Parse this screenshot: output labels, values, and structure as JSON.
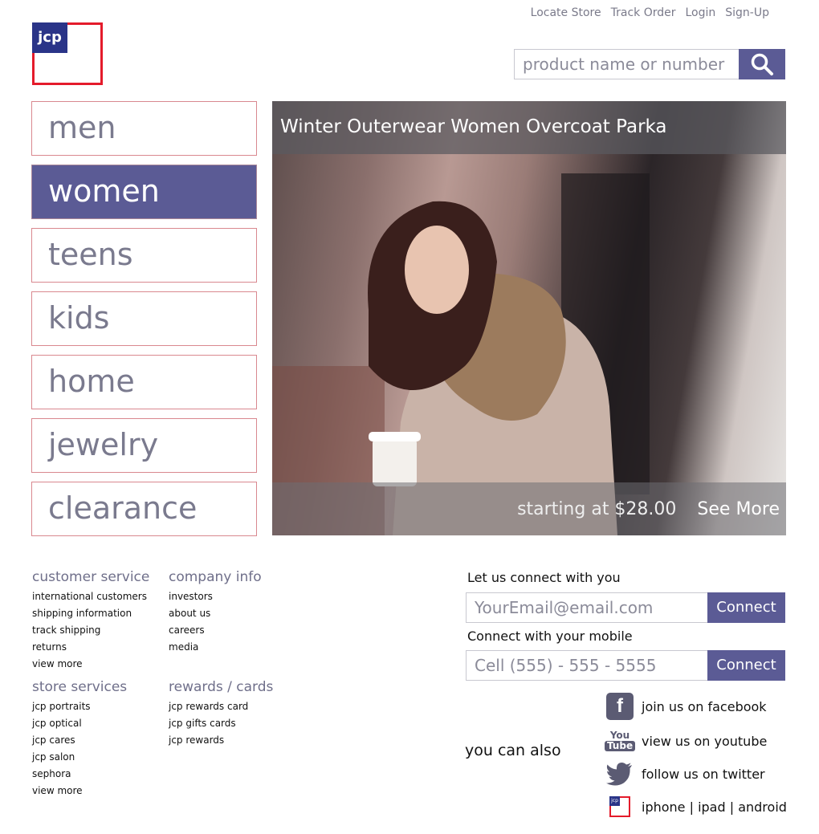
{
  "header": {
    "links": [
      "Locate Store",
      "Track Order",
      "Login",
      "Sign-Up"
    ],
    "logo_text": "jcp",
    "search": {
      "placeholder": "product name or number"
    }
  },
  "nav": {
    "items": [
      "men",
      "women",
      "teens",
      "kids",
      "home",
      "jewelry",
      "clearance"
    ],
    "active": "women"
  },
  "hero": {
    "title": "Winter Outerwear Women Overcoat Parka",
    "price_text": "starting at $28.00",
    "see_more": "See More"
  },
  "footer": {
    "customer_service": {
      "heading": "customer service",
      "links": [
        "international customers",
        "shipping information",
        "track shipping",
        "returns",
        "view more"
      ]
    },
    "company_info": {
      "heading": "company info",
      "links": [
        "investors",
        "about us",
        "careers",
        "media"
      ]
    },
    "store_services": {
      "heading": "store services",
      "links": [
        "jcp portraits",
        "jcp optical",
        "jcp cares",
        "jcp salon",
        "sephora",
        "view more"
      ]
    },
    "rewards_cards": {
      "heading": "rewards / cards",
      "links": [
        "jcp rewards card",
        "jcp gifts cards",
        "jcp rewards"
      ]
    }
  },
  "connect": {
    "email_label": "Let us connect with you",
    "email_placeholder": "YourEmail@email.com",
    "mobile_label": "Connect with your mobile",
    "mobile_placeholder": "Cell (555) - 555 - 5555",
    "button_label": "Connect"
  },
  "social": {
    "also_label": "you can also",
    "facebook": "join us on facebook",
    "youtube": "view us on youtube",
    "youtube_icon_top": "You",
    "youtube_icon_bottom": "Tube",
    "twitter": "follow us on twitter",
    "apps": "iphone | ipad | android"
  },
  "colors": {
    "accent": "#5b5b95",
    "brand_red": "#e41b2b",
    "brand_blue": "#2a3488",
    "muted_text": "#7a7a8e"
  }
}
